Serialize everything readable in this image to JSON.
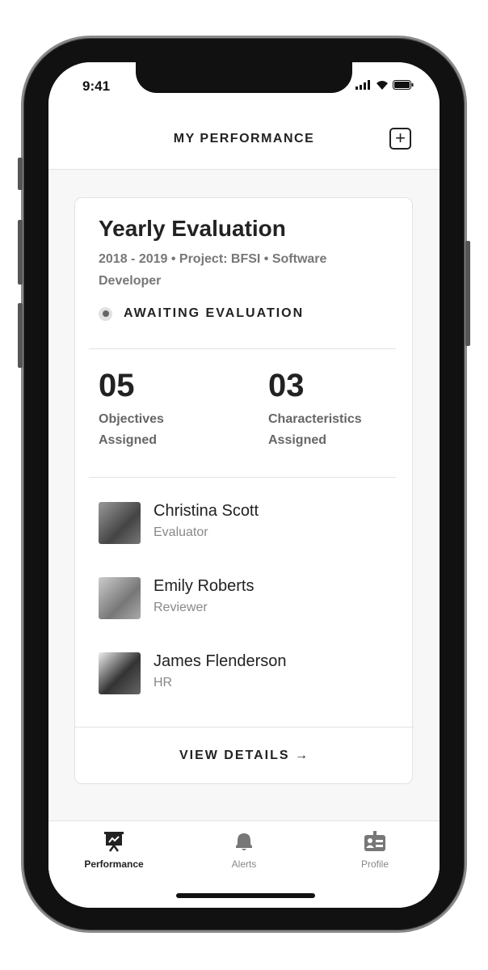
{
  "status_bar": {
    "time": "9:41"
  },
  "header": {
    "title": "MY PERFORMANCE",
    "add_icon": "plus-icon"
  },
  "card": {
    "title": "Yearly Evaluation",
    "subtitle": "2018 - 2019 • Project: BFSI • Software Developer",
    "status": "AWAITING EVALUATION",
    "stats": [
      {
        "value": "05",
        "label1": "Objectives",
        "label2": "Assigned"
      },
      {
        "value": "03",
        "label1": "Characteristics",
        "label2": "Assigned"
      }
    ],
    "people": [
      {
        "name": "Christina Scott",
        "role": "Evaluator"
      },
      {
        "name": "Emily Roberts",
        "role": "Reviewer"
      },
      {
        "name": "James Flenderson",
        "role": "HR"
      }
    ],
    "view_details": "VIEW DETAILS →"
  },
  "tabs": [
    {
      "label": "Performance",
      "icon": "presentation-chart-icon",
      "active": true
    },
    {
      "label": "Alerts",
      "icon": "bell-icon"
    },
    {
      "label": "Profile",
      "icon": "id-badge-icon"
    }
  ]
}
